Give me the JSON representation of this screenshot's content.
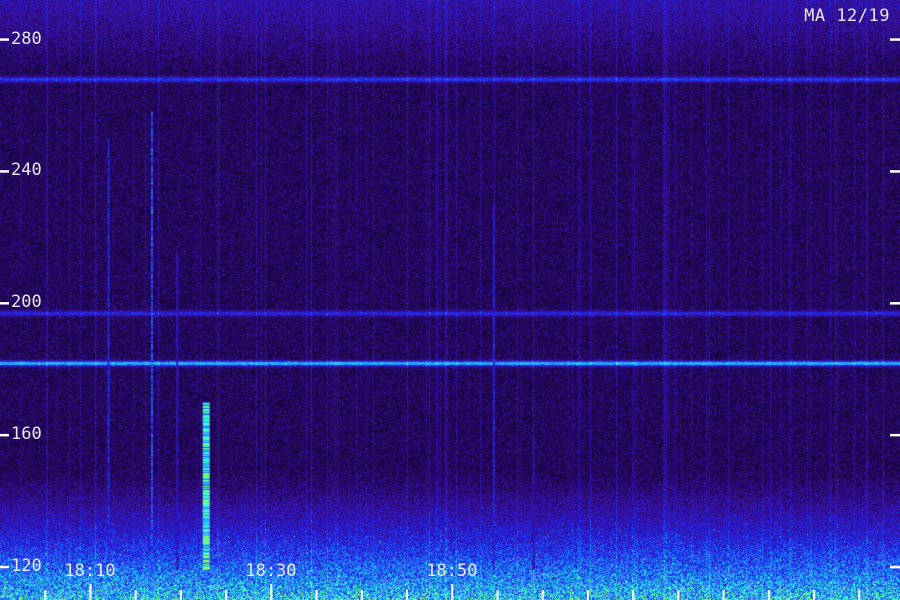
{
  "station_label": "MA 12/19",
  "chart_data": {
    "type": "heatmap",
    "title": "",
    "xlabel": "",
    "ylabel": "",
    "ylim": [
      110,
      292
    ],
    "yticks": [
      120,
      160,
      200,
      240,
      280
    ],
    "ytick_labels": [
      "120",
      "160",
      "200",
      "240",
      "280"
    ],
    "xlim": [
      18.0,
      18.995
    ],
    "xticks": [
      18.1,
      18.3,
      18.5
    ],
    "xtick_labels": [
      "18:10",
      "18:30",
      "18:50"
    ],
    "x_minor_step": 0.05,
    "colormap": [
      "#000000",
      "#1a0440",
      "#3a10a0",
      "#2020e0",
      "#2060ff",
      "#20c0ff",
      "#40ffd0",
      "#a0ff40"
    ],
    "features": [
      {
        "kind": "horizontal-band",
        "y": 182,
        "intensity": 0.55
      },
      {
        "kind": "horizontal-band",
        "y": 197,
        "intensity": 0.25
      },
      {
        "kind": "horizontal-band",
        "y": 268,
        "intensity": 0.3
      },
      {
        "kind": "vertical-burst",
        "x": 18.228,
        "y_top": 170,
        "intensity": 0.95
      },
      {
        "kind": "vertical-line",
        "x": 18.168,
        "y_top": 258,
        "intensity": 0.65
      },
      {
        "kind": "vertical-line",
        "x": 18.12,
        "y_top": 250,
        "intensity": 0.55
      },
      {
        "kind": "vertical-line",
        "x": 18.196,
        "y_top": 215,
        "intensity": 0.45
      },
      {
        "kind": "vertical-line",
        "x": 18.546,
        "y_top": 230,
        "intensity": 0.5
      },
      {
        "kind": "vertical-line",
        "x": 18.59,
        "y_top": 160,
        "intensity": 0.4
      }
    ]
  }
}
